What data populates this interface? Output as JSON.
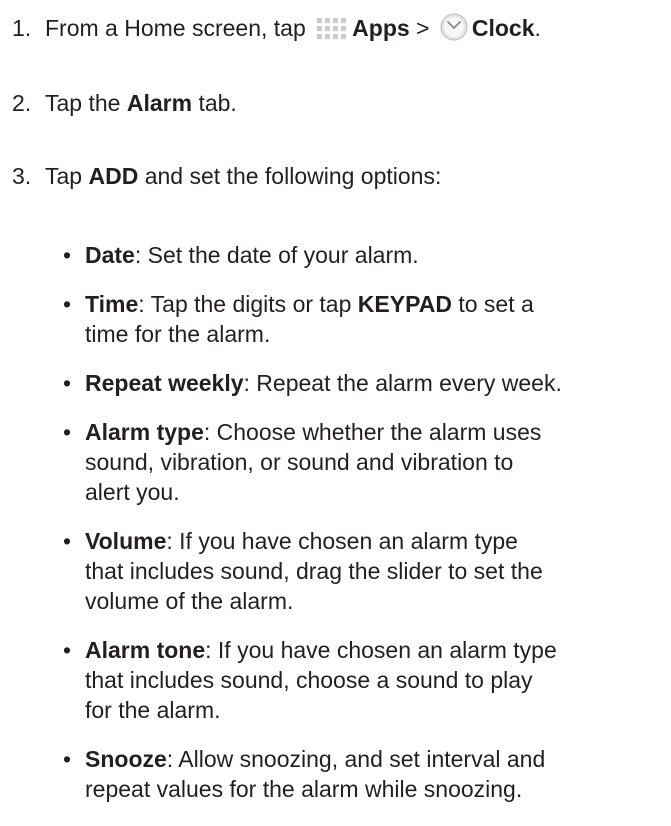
{
  "steps": [
    {
      "num": "1.",
      "pre": "From a Home screen, tap",
      "apps": "Apps",
      "sep": ">",
      "clock": "Clock",
      "end": "."
    },
    {
      "num": "2.",
      "pre": "Tap the",
      "bold": "Alarm",
      "post": "tab."
    },
    {
      "num": "3.",
      "pre": "Tap",
      "bold": "ADD",
      "post": "and set the following options:"
    }
  ],
  "options": [
    {
      "term": "Date",
      "desc": ": Set the date of your alarm."
    },
    {
      "term": "Time",
      "desc_a": ": Tap the digits or tap ",
      "keypad": "KEYPAD",
      "desc_b": " to set a",
      "desc_c": "time for the alarm."
    },
    {
      "term": "Repeat weekly",
      "desc": ": Repeat the alarm every week."
    },
    {
      "term": "Alarm type",
      "desc_1": ": Choose whether the alarm uses",
      "desc_2": "sound, vibration, or sound and vibration to",
      "desc_3": "alert you."
    },
    {
      "term": "Volume",
      "desc_1": ": If you have chosen an alarm type",
      "desc_2": "that includes sound, drag the slider to set the",
      "desc_3": "volume of the alarm."
    },
    {
      "term": "Alarm tone",
      "desc_1": ": If you have chosen an alarm type",
      "desc_2": "that includes sound, choose a sound to play",
      "desc_3": "for the alarm."
    },
    {
      "term": "Snooze",
      "desc_1": ": Allow snoozing, and set interval and",
      "desc_2": "repeat values for the alarm while snoozing."
    }
  ],
  "bullet": "•",
  "icons": {
    "apps": "apps-grid-icon",
    "clock": "clock-icon"
  }
}
